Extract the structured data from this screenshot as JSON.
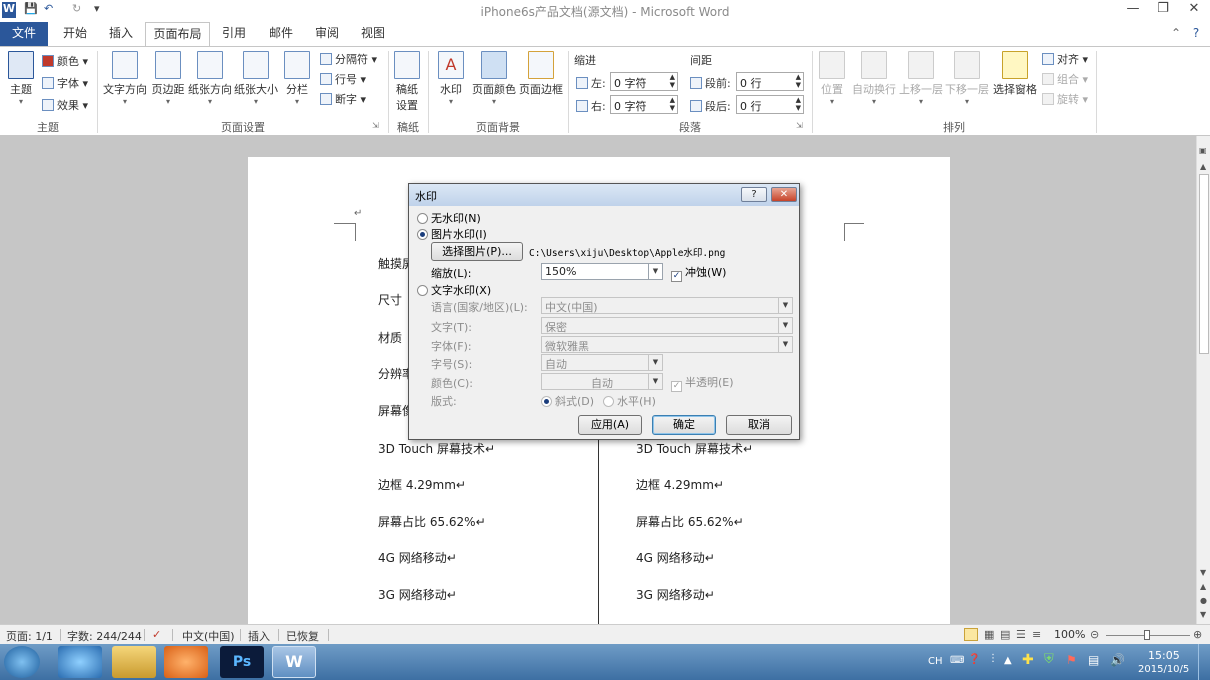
{
  "window": {
    "title": "iPhone6s产品文档(源文档)  -  Microsoft Word"
  },
  "tabs": {
    "file": "文件",
    "items": [
      "开始",
      "插入",
      "页面布局",
      "引用",
      "邮件",
      "审阅",
      "视图"
    ],
    "active": "页面布局"
  },
  "ribbon": {
    "theme": {
      "themes": "主题",
      "colors": "颜色",
      "fonts": "字体",
      "effects": "效果",
      "group": "主题"
    },
    "page_setup": {
      "text_dir": "文字方向",
      "margins": "页边距",
      "orientation": "纸张方向",
      "size": "纸张大小",
      "columns": "分栏",
      "breaks": "分隔符",
      "line_numbers": "行号",
      "hyphenation": "断字",
      "group": "页面设置"
    },
    "draft": {
      "label": "稿纸\n设置",
      "label1": "稿纸",
      "label2": "设置",
      "group": "稿纸"
    },
    "page_bg": {
      "watermark": "水印",
      "page_color": "页面颜色",
      "page_borders": "页面边框",
      "group": "页面背景"
    },
    "paragraph": {
      "indent": "缩进",
      "left": "左:",
      "left_val": "0 字符",
      "right": "右:",
      "right_val": "0 字符",
      "spacing": "间距",
      "before": "段前:",
      "before_val": "0 行",
      "after": "段后:",
      "after_val": "0 行",
      "group": "段落"
    },
    "arrange": {
      "position": "位置",
      "wrap": "自动换行",
      "forward": "上移一层",
      "backward": "下移一层",
      "pane": "选择窗格",
      "align": "对齐",
      "group_btn": "组合",
      "rotate": "旋转",
      "group": "排列"
    }
  },
  "document": {
    "left_col": [
      "触摸屏",
      "尺寸",
      "材质",
      "分辨率",
      "屏幕像",
      "3D Touch 屏幕技术↵",
      "边框 4.29mm↵",
      "屏幕占比 65.62%↵",
      "4G 网络移动↵",
      "3G 网络移动↵"
    ],
    "right_col": [
      "3D Touch 屏幕技术↵",
      "边框 4.29mm↵",
      "屏幕占比 65.62%↵",
      "4G 网络移动↵",
      "3G 网络移动↵"
    ],
    "para_mark": "↵"
  },
  "dialog": {
    "title": "水印",
    "help": "?",
    "close": "✕",
    "no_watermark": "无水印(N)",
    "picture_watermark": "图片水印(I)",
    "select_picture": "选择图片(P)...",
    "picture_path": "C:\\Users\\xiju\\Desktop\\Apple水印.png",
    "scale_label": "缩放(L):",
    "scale_value": "150%",
    "washout": "冲蚀(W)",
    "text_watermark": "文字水印(X)",
    "language_label": "语言(国家/地区)(L):",
    "language_value": "中文(中国)",
    "text_label": "文字(T):",
    "text_value": "保密",
    "font_label": "字体(F):",
    "font_value": "微软雅黑",
    "size_label": "字号(S):",
    "size_value": "自动",
    "color_label": "颜色(C):",
    "color_value": "自动",
    "semi_transparent": "半透明(E)",
    "layout_label": "版式:",
    "diagonal": "斜式(D)",
    "horizontal": "水平(H)",
    "apply": "应用(A)",
    "ok": "确定",
    "cancel": "取消"
  },
  "status": {
    "page": "页面: 1/1",
    "words": "字数: 244/244",
    "language": "中文(中国)",
    "insert": "插入",
    "recovered": "已恢复",
    "zoom": "100%"
  },
  "taskbar": {
    "ime": "CH",
    "time": "15:05",
    "date": "2015/10/5"
  },
  "colors": {
    "accent": "#2b579a",
    "taskbar": "#4a7db0"
  }
}
